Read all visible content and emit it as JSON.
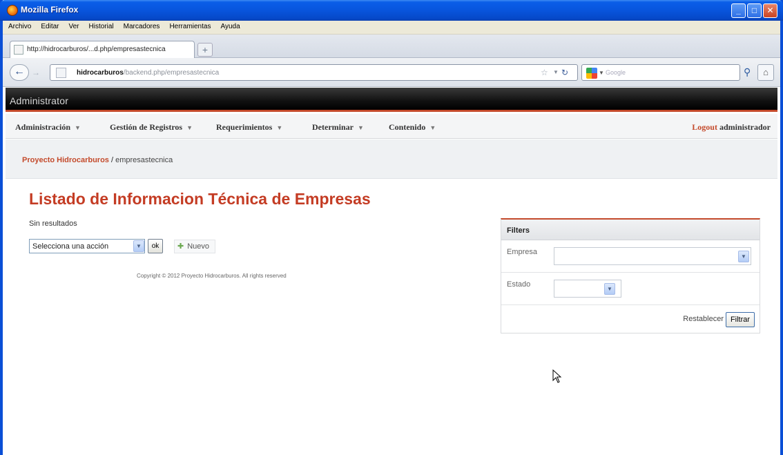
{
  "window": {
    "title": "Mozilla Firefox"
  },
  "menubar": [
    "Archivo",
    "Editar",
    "Ver",
    "Historial",
    "Marcadores",
    "Herramientas",
    "Ayuda"
  ],
  "tab": {
    "label": "http://hidrocarburos/...d.php/empresastecnica",
    "newtab": "+"
  },
  "urlbar": {
    "host": "hidrocarburos",
    "path": "/backend.php/empresastecnica"
  },
  "searchbar": {
    "placeholder": "Google"
  },
  "admin": {
    "title": "Administrator"
  },
  "nav": {
    "items": [
      "Administración",
      "Gestión de Registros",
      "Requerimientos",
      "Determinar",
      "Contenido"
    ],
    "logout": "Logout",
    "user": "administrador"
  },
  "breadcrumb": {
    "home": "Proyecto Hidrocarburos",
    "separator": " / ",
    "current": "empresastecnica"
  },
  "main": {
    "title": "Listado de Informacion Técnica de Empresas",
    "no_results": "Sin resultados",
    "action_select": "Selecciona una acción",
    "ok_label": "ok",
    "new_label": "Nuevo",
    "copyright": "Copyright © 2012 Proyecto Hidrocarburos. All rights reserved"
  },
  "filters": {
    "title": "Filters",
    "empresa_label": "Empresa",
    "empresa_value": "",
    "estado_label": "Estado",
    "estado_value": "",
    "reset_label": "Restablecer",
    "filter_label": "Filtrar"
  }
}
